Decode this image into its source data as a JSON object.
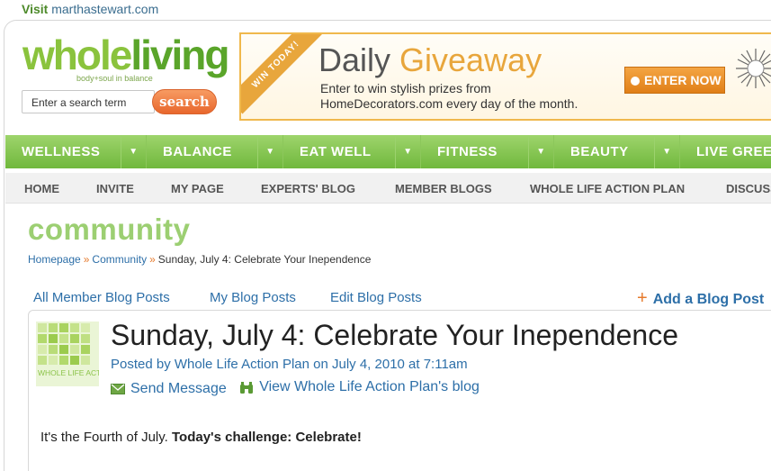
{
  "topbar": {
    "visit_bold": "Visit",
    "visit_site": "marthastewart.com"
  },
  "logo": {
    "word_a": "whole",
    "word_b": "living",
    "tagline": "body+soul in balance"
  },
  "search": {
    "placeholder": "Enter a search term",
    "button": "search"
  },
  "banner": {
    "ribbon": "WIN TODAY!",
    "title_a": "Daily ",
    "title_b": "Giveaway",
    "line1": "Enter to win stylish prizes from",
    "line2": "HomeDecorators.com every day of the month.",
    "enter": "ENTER NOW"
  },
  "mainnav": [
    {
      "label": "WELLNESS"
    },
    {
      "label": "BALANCE"
    },
    {
      "label": "EAT WELL"
    },
    {
      "label": "FITNESS"
    },
    {
      "label": "BEAUTY"
    },
    {
      "label": "LIVE GREEN"
    }
  ],
  "subnav": [
    "HOME",
    "INVITE",
    "MY PAGE",
    "EXPERTS' BLOG",
    "MEMBER BLOGS",
    "WHOLE LIFE ACTION PLAN",
    "DISCUSSIONS"
  ],
  "section_title": "community",
  "breadcrumb": {
    "home": "Homepage",
    "community": "Community",
    "current": "Sunday, July 4: Celebrate Your Inependence"
  },
  "tabs": [
    "All Member Blog Posts",
    "My Blog Posts",
    "Edit Blog Posts"
  ],
  "add_post": "Add a Blog Post",
  "post": {
    "title": "Sunday, July 4: Celebrate Your Inependence",
    "posted_by": "Posted by Whole Life Action Plan on July 4, 2010 at 7:11am",
    "send_message": "Send Message",
    "view_blog": "View Whole Life Action Plan's blog",
    "avatar_text": "WHOLE LIFE ACTION PLAN",
    "body_plain": "It's the Fourth of July. ",
    "body_bold": "Today's challenge: Celebrate!"
  },
  "colors": {
    "green": "#70b83c",
    "link": "#2d6fa8",
    "orange": "#e67a2c"
  }
}
